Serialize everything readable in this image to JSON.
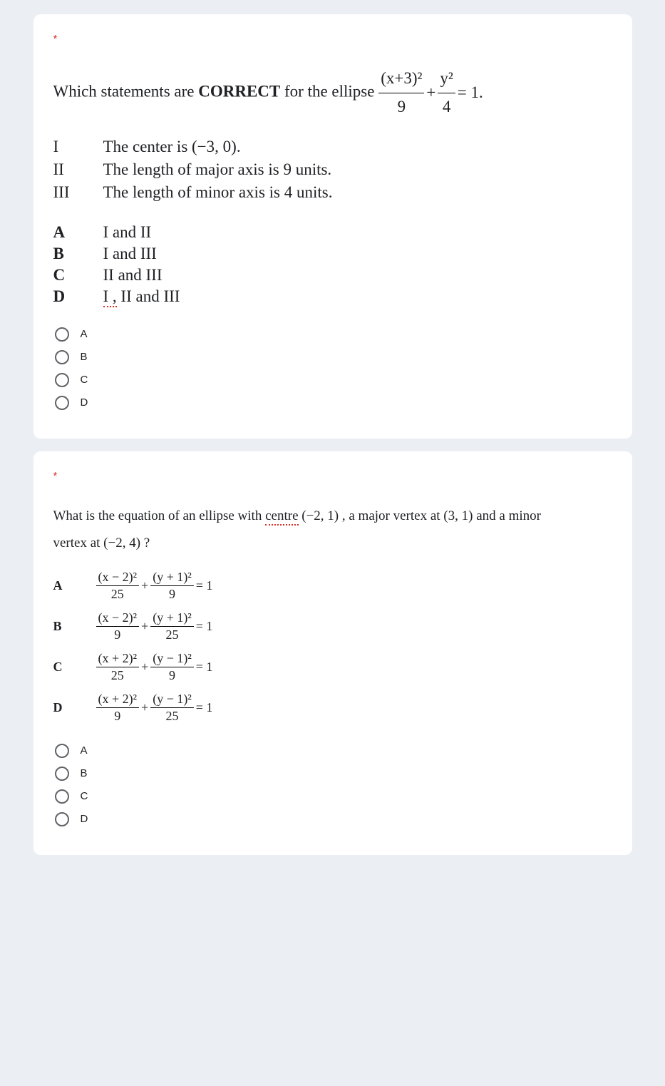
{
  "q1": {
    "required_marker": "*",
    "prompt_prefix": "Which statements are ",
    "prompt_bold": "CORRECT",
    "prompt_suffix": " for the ellipse ",
    "eq_num1": "(x+3)²",
    "eq_den1": "9",
    "eq_plus": "+",
    "eq_num2": "y²",
    "eq_den2": "4",
    "eq_tail": " = 1.",
    "statements": [
      {
        "rn": "I",
        "text": "The center is (−3, 0)."
      },
      {
        "rn": "II",
        "text": "The length of major axis is 9 units."
      },
      {
        "rn": "III",
        "text": "The length of minor axis is 4 units."
      }
    ],
    "answers": [
      {
        "rn": "A",
        "text": "I and II"
      },
      {
        "rn": "B",
        "text": "I and III"
      },
      {
        "rn": "C",
        "text": "II and III"
      },
      {
        "rn": "D",
        "text_underline": "I ,",
        "text_rest": " II and III"
      }
    ],
    "options": [
      "A",
      "B",
      "C",
      "D"
    ]
  },
  "q2": {
    "required_marker": "*",
    "prompt_a": "What is the equation of an ellipse with ",
    "prompt_centre": "centre",
    "prompt_b": " (−2, 1) ,  a major vertex at (3, 1) and a minor",
    "prompt_c": "vertex at (−2, 4) ?",
    "answers": [
      {
        "rn": "A",
        "n1": "(x − 2)²",
        "d1": "25",
        "n2": "(y + 1)²",
        "d2": "9"
      },
      {
        "rn": "B",
        "n1": "(x − 2)²",
        "d1": "9",
        "n2": "(y + 1)²",
        "d2": "25"
      },
      {
        "rn": "C",
        "n1": "(x + 2)²",
        "d1": "25",
        "n2": "(y − 1)²",
        "d2": "9"
      },
      {
        "rn": "D",
        "n1": "(x + 2)²",
        "d1": "9",
        "n2": "(y − 1)²",
        "d2": "25"
      }
    ],
    "eq_plus": " + ",
    "eq_tail": " = 1",
    "options": [
      "A",
      "B",
      "C",
      "D"
    ]
  }
}
